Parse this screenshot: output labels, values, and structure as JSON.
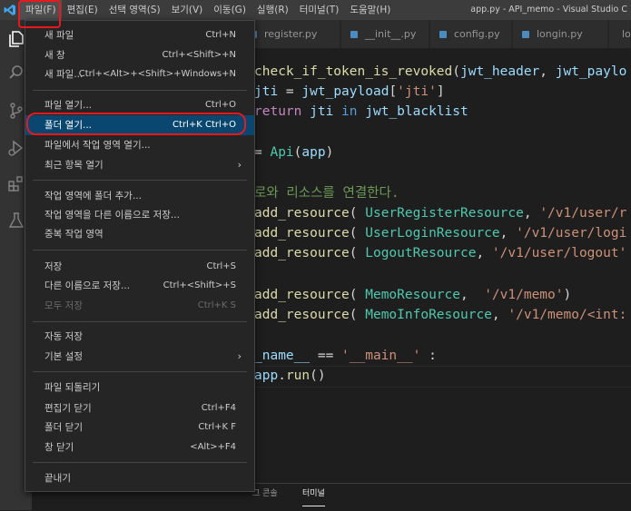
{
  "window": {
    "title": "app.py - API_memo - Visual Studio C"
  },
  "menubar": {
    "items": [
      {
        "label": "파일(F)"
      },
      {
        "label": "편집(E)"
      },
      {
        "label": "선택 영역(S)"
      },
      {
        "label": "보기(V)"
      },
      {
        "label": "이동(G)"
      },
      {
        "label": "실행(R)"
      },
      {
        "label": "터미널(T)"
      },
      {
        "label": "도움말(H)"
      }
    ]
  },
  "tabs": [
    {
      "label": "register.py"
    },
    {
      "label": "__init__.py"
    },
    {
      "label": "config.py"
    },
    {
      "label": "longin.py"
    },
    {
      "label": "lo"
    }
  ],
  "file_menu": {
    "items": [
      {
        "label": "새 파일",
        "shortcut": "Ctrl+N"
      },
      {
        "label": "새 창",
        "shortcut": "Ctrl+<Shift>+N"
      },
      {
        "label": "새 파일...",
        "shortcut": "Ctrl+<Alt>+<Shift>+Windows+N"
      },
      {
        "label": "파일 열기...",
        "shortcut": "Ctrl+O"
      },
      {
        "label": "폴더 열기...",
        "shortcut": "Ctrl+K Ctrl+O"
      },
      {
        "label": "파일에서 작업 영역 열기...",
        "shortcut": ""
      },
      {
        "label": "최근 항목 열기",
        "shortcut": "",
        "submenu_arrow": "›"
      },
      {
        "label": "작업 영역에 폴더 추가...",
        "shortcut": ""
      },
      {
        "label": "작업 영역을 다른 이름으로 저장...",
        "shortcut": ""
      },
      {
        "label": "중복 작업 영역",
        "shortcut": ""
      },
      {
        "label": "저장",
        "shortcut": "Ctrl+S"
      },
      {
        "label": "다른 이름으로 저장...",
        "shortcut": "Ctrl+<Shift>+S"
      },
      {
        "label": "모두 저장",
        "shortcut": "Ctrl+K S"
      },
      {
        "label": "자동 저장",
        "shortcut": ""
      },
      {
        "label": "기본 설정",
        "shortcut": "",
        "submenu_arrow": "›"
      },
      {
        "label": "파일 되돌리기",
        "shortcut": ""
      },
      {
        "label": "편집기 닫기",
        "shortcut": "Ctrl+F4"
      },
      {
        "label": "폴더 닫기",
        "shortcut": "Ctrl+K F"
      },
      {
        "label": "창 닫기",
        "shortcut": "<Alt>+F4"
      },
      {
        "label": "끝내기",
        "shortcut": ""
      }
    ]
  },
  "code": {
    "l1": {
      "a": "check_if_token_is_revoked",
      "b": "(",
      "c": "jwt_header",
      ",": ", ",
      "d": "jwt_paylo"
    },
    "l2": {
      "a": "jti",
      "b": " = ",
      "c": "jwt_payload",
      "d": "[",
      "e": "'jti'",
      "f": "]"
    },
    "l3": {
      "a": "return",
      "b": " jti ",
      "c": "in",
      "d": " ",
      "e": "jwt_blacklist"
    },
    "l4": {
      "a": "= ",
      "b": "Api",
      "c": "(",
      "d": "app",
      "e": ")"
    },
    "l5": {
      "a": "로와 리소스를 연결한다."
    },
    "l6": {
      "a": "add_resource",
      "b": "( ",
      "c": "UserRegisterResource",
      ",": ", ",
      "d": "'/v1/user/r"
    },
    "l7": {
      "a": "add_resource",
      "b": "( ",
      "c": "UserLoginResource",
      ",": ", ",
      "d": "'/v1/user/logi"
    },
    "l8": {
      "a": "add_resource",
      "b": "( ",
      "c": "LogoutResource",
      ",": ", ",
      "d": "'/v1/user/logout'"
    },
    "l9": {
      "a": "add_resource",
      "b": "( ",
      "c": "MemoResource",
      ",": ",  ",
      "d": "'/v1/memo'",
      "e": ")"
    },
    "l10": {
      "a": "add_resource",
      "b": "( ",
      "c": "MemoInfoResource",
      ",": ", ",
      "d": "'/v1/memo/<int:"
    },
    "l11": {
      "a": "_name__",
      "b": " == ",
      "c": "'__main__'",
      "d": " :"
    },
    "l12": {
      "a": "app",
      "b": ".",
      "c": "run",
      "d": "()"
    }
  },
  "panel": {
    "tabs": [
      {
        "label": "그 콘솔"
      },
      {
        "label": "터미널"
      }
    ]
  },
  "colors": {
    "highlight": "#094771",
    "annotation": "#e8191e"
  }
}
